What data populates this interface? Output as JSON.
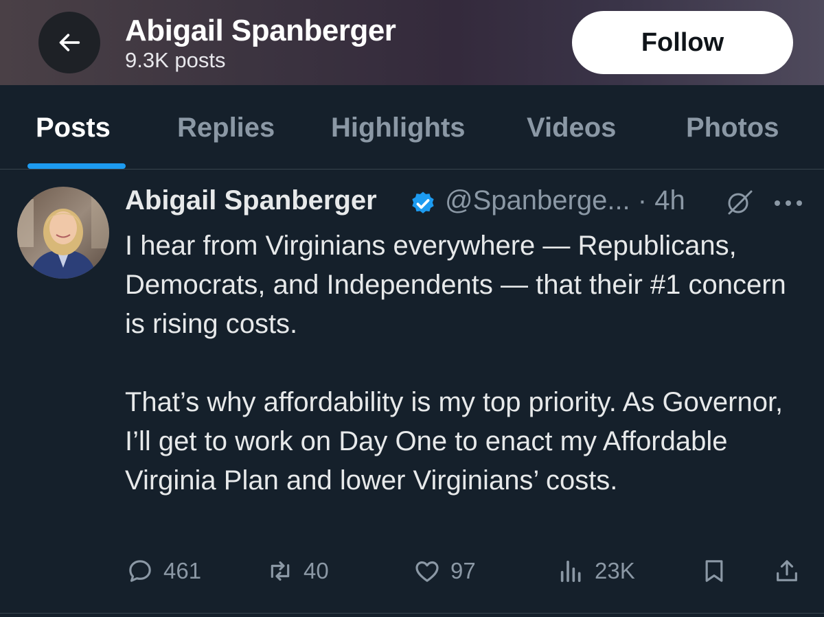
{
  "header": {
    "name": "Abigail Spanberger",
    "posts_count": "9.3K posts",
    "follow_label": "Follow",
    "back_icon": "arrow-left-icon"
  },
  "tabs": [
    {
      "label": "Posts",
      "active": true
    },
    {
      "label": "Replies",
      "active": false
    },
    {
      "label": "Highlights",
      "active": false
    },
    {
      "label": "Videos",
      "active": false
    },
    {
      "label": "Photos",
      "active": false
    }
  ],
  "tweet": {
    "author_name": "Abigail Spanberger",
    "handle": "@Spanberge...",
    "time": "· 4h",
    "verified": true,
    "paragraphs": [
      "I hear from Virginians everywhere — Republicans, Democrats, and Independents — that their #1 concern is rising costs.",
      "That’s why affordability is my top priority. As Governor, I’ll get to work on Day One to enact my Affordable Virginia Plan and lower Virginians’ costs."
    ],
    "actions": {
      "replies": "461",
      "reposts": "40",
      "likes": "97",
      "views": "23K"
    }
  },
  "colors": {
    "background": "#15202b",
    "accent": "#1d9bf0",
    "secondary_text": "#8b98a5",
    "primary_text": "#e7e9ea"
  }
}
